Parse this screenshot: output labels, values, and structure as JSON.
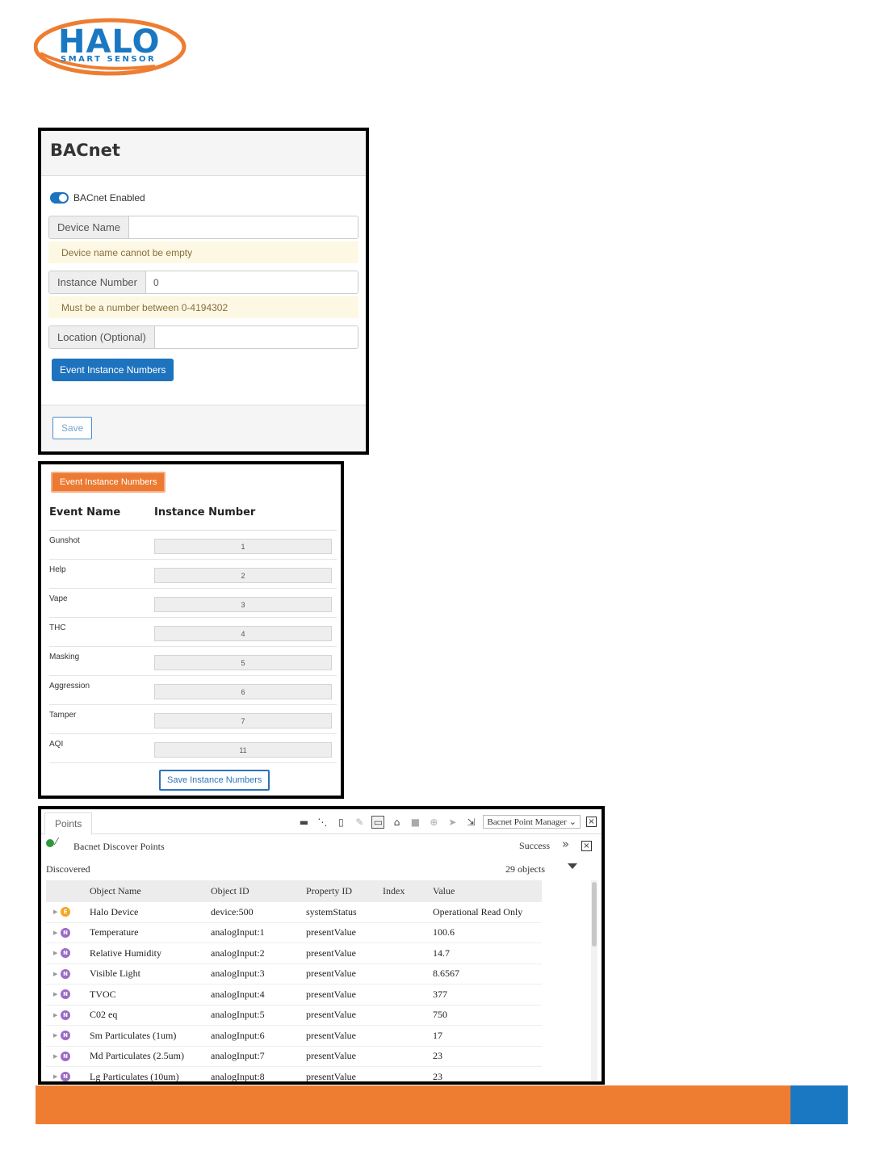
{
  "logo": {
    "title": "HALO",
    "subtitle": "SMART SENSOR"
  },
  "bacnet": {
    "title": "BACnet",
    "toggle_label": "BACnet Enabled",
    "device_name_label": "Device Name",
    "device_name_value": "",
    "device_name_warning": "Device name cannot be empty",
    "instance_number_label": "Instance Number",
    "instance_number_value": "0",
    "instance_number_warning": "Must be a number between 0-4194302",
    "location_label": "Location (Optional)",
    "location_value": "",
    "event_button": "Event Instance Numbers",
    "save_button": "Save"
  },
  "events": {
    "header_button": "Event Instance Numbers",
    "col_event": "Event Name",
    "col_instance": "Instance Number",
    "rows": [
      {
        "name": "Gunshot",
        "value": "1"
      },
      {
        "name": "Help",
        "value": "2"
      },
      {
        "name": "Vape",
        "value": "3"
      },
      {
        "name": "THC",
        "value": "4"
      },
      {
        "name": "Masking",
        "value": "5"
      },
      {
        "name": "Aggression",
        "value": "6"
      },
      {
        "name": "Tamper",
        "value": "7"
      },
      {
        "name": "AQI",
        "value": "11"
      }
    ],
    "save_button": "Save Instance Numbers"
  },
  "points": {
    "tab": "Points",
    "manager_select": "Bacnet Point Manager",
    "job_title": "Bacnet Discover Points",
    "job_status": "Success",
    "discovered_label": "Discovered",
    "object_count": "29 objects",
    "columns": [
      "Object Name",
      "Object ID",
      "Property ID",
      "Index",
      "Value"
    ],
    "rows": [
      {
        "badge": "E",
        "name": "Halo Device",
        "id": "device:500",
        "prop": "systemStatus",
        "index": "",
        "value": "Operational Read Only"
      },
      {
        "badge": "N",
        "name": "Temperature",
        "id": "analogInput:1",
        "prop": "presentValue",
        "index": "",
        "value": "100.6"
      },
      {
        "badge": "N",
        "name": "Relative Humidity",
        "id": "analogInput:2",
        "prop": "presentValue",
        "index": "",
        "value": "14.7"
      },
      {
        "badge": "N",
        "name": "Visible Light",
        "id": "analogInput:3",
        "prop": "presentValue",
        "index": "",
        "value": "8.6567"
      },
      {
        "badge": "N",
        "name": "TVOC",
        "id": "analogInput:4",
        "prop": "presentValue",
        "index": "",
        "value": "377"
      },
      {
        "badge": "N",
        "name": "C02 eq",
        "id": "analogInput:5",
        "prop": "presentValue",
        "index": "",
        "value": "750"
      },
      {
        "badge": "N",
        "name": "Sm Particulates (1um)",
        "id": "analogInput:6",
        "prop": "presentValue",
        "index": "",
        "value": "17"
      },
      {
        "badge": "N",
        "name": "Md Particulates (2.5um)",
        "id": "analogInput:7",
        "prop": "presentValue",
        "index": "",
        "value": "23"
      },
      {
        "badge": "N",
        "name": "Lg Particulates (10um)",
        "id": "analogInput:8",
        "prop": "presentValue",
        "index": "",
        "value": "23"
      }
    ]
  },
  "colors": {
    "brand_orange": "#ee7d31",
    "brand_blue": "#1a78c2",
    "primary_button": "#1e73be"
  }
}
